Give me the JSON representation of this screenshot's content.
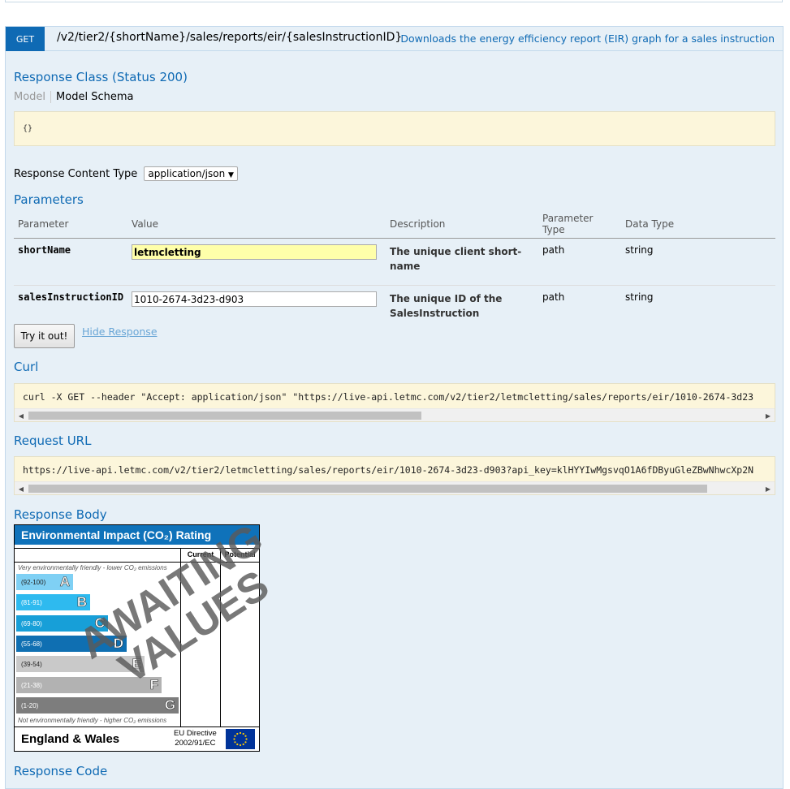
{
  "operation": {
    "method": "GET",
    "path": "/v2/tier2/{shortName}/sales/reports/eir/{salesInstructionID}",
    "summary": "Downloads the energy efficiency report (EIR) graph for a sales instruction"
  },
  "response_class": {
    "title": "Response Class (Status 200)",
    "tab_model": "Model",
    "tab_schema": "Model Schema",
    "schema": "{}"
  },
  "content_type": {
    "label": "Response Content Type",
    "selected": "application/json"
  },
  "parameters": {
    "title": "Parameters",
    "headers": [
      "Parameter",
      "Value",
      "Description",
      "Parameter Type",
      "Data Type"
    ],
    "rows": [
      {
        "name": "shortName",
        "value": "letmcletting",
        "description": "The unique client short-name",
        "param_type": "path",
        "data_type": "string"
      },
      {
        "name": "salesInstructionID",
        "value": "1010-2674-3d23-d903",
        "description": "The unique ID of the SalesInstruction",
        "param_type": "path",
        "data_type": "string"
      }
    ]
  },
  "actions": {
    "try_label": "Try it out!",
    "hide_label": "Hide Response"
  },
  "curl": {
    "title": "Curl",
    "text": "curl -X GET --header \"Accept: application/json\" \"https://live-api.letmc.com/v2/tier2/letmcletting/sales/reports/eir/1010-2674-3d23"
  },
  "request_url": {
    "title": "Request URL",
    "text": "https://live-api.letmc.com/v2/tier2/letmcletting/sales/reports/eir/1010-2674-3d23-d903?api_key=klHYYIwMgsvqO1A6fDByuGleZBwNhwcXp2N"
  },
  "response_body": {
    "title": "Response Body",
    "chart": {
      "title": "Environmental Impact (CO₂) Rating",
      "col_current": "Current",
      "col_potential": "Potential",
      "note_top": "Very environmentally friendly - lower CO₂ emissions",
      "note_bottom": "Not environmentally friendly - higher CO₂ emissions",
      "bands": [
        {
          "range": "(92-100)",
          "letter": "A",
          "color": "#7fd0f4"
        },
        {
          "range": "(81-91)",
          "letter": "B",
          "color": "#2ebaef"
        },
        {
          "range": "(69-80)",
          "letter": "C",
          "color": "#179fd8"
        },
        {
          "range": "(55-68)",
          "letter": "D",
          "color": "#0f6fb2"
        },
        {
          "range": "(39-54)",
          "letter": "E",
          "color": "#c9c9c9"
        },
        {
          "range": "(21-38)",
          "letter": "F",
          "color": "#b2b2b2"
        },
        {
          "range": "(1-20)",
          "letter": "G",
          "color": "#7d7d7d"
        }
      ],
      "watermark_line1": "AWAITING",
      "watermark_line2": "VALUES",
      "country": "England & Wales",
      "directive_line1": "EU Directive",
      "directive_line2": "2002/91/EC"
    }
  },
  "response_code": {
    "title": "Response Code"
  },
  "colors": {
    "accent": "#0f6ab4",
    "panel_bg": "#e7f0f7",
    "code_bg": "#fcf6db"
  }
}
